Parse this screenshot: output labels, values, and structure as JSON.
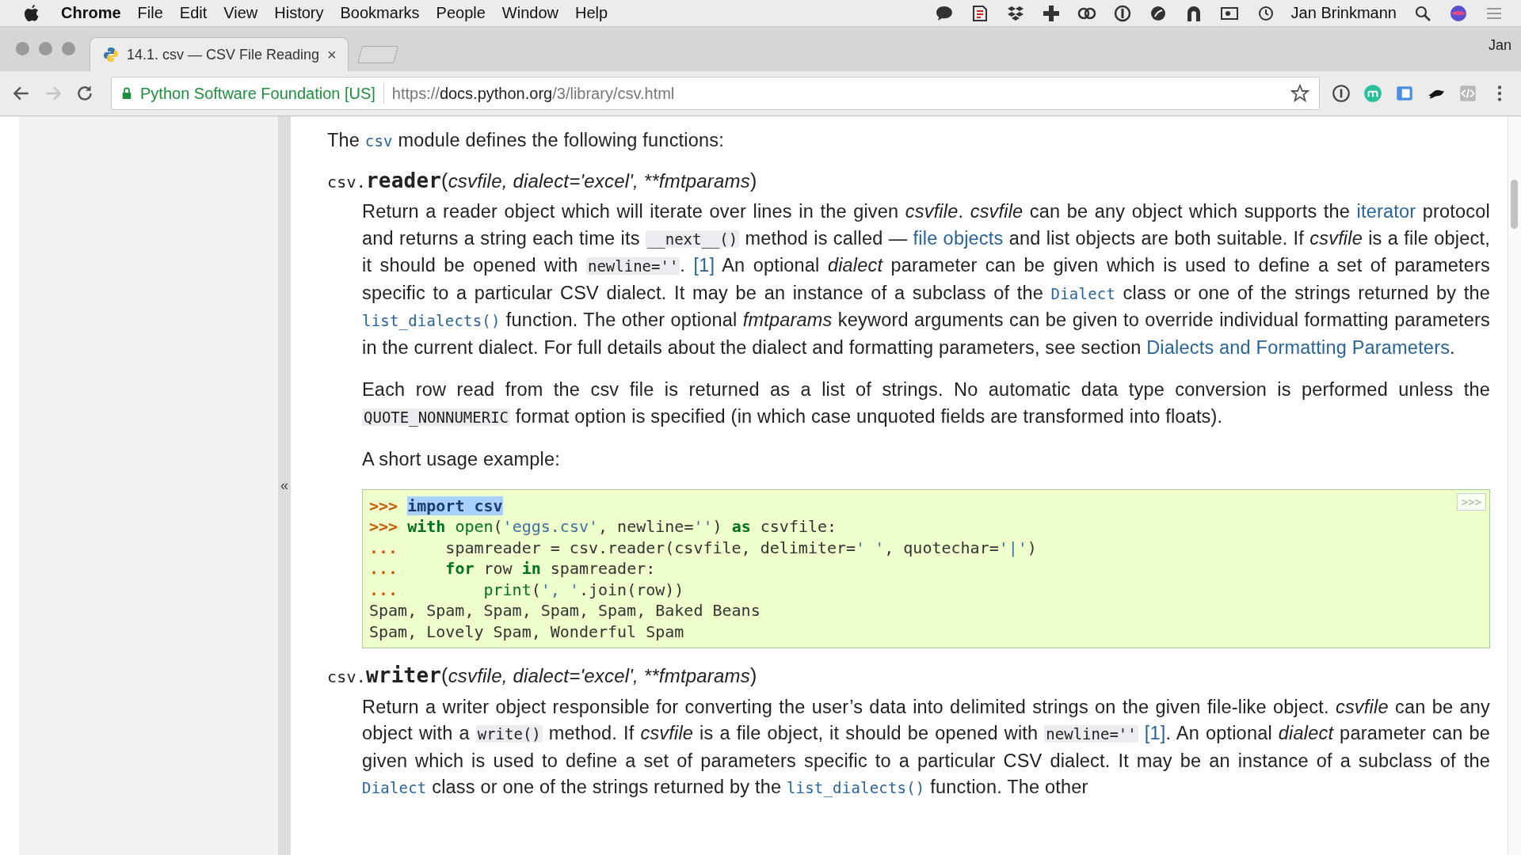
{
  "menu_bar": {
    "app_name": "Chrome",
    "menus": [
      "File",
      "Edit",
      "View",
      "History",
      "Bookmarks",
      "People",
      "Window",
      "Help"
    ],
    "user": "Jan Brinkmann"
  },
  "tabs": [
    {
      "title": "14.1. csv — CSV File Reading",
      "selected": true,
      "close": "×"
    }
  ],
  "profile": "Jan",
  "toolbar": {
    "back_enabled": true,
    "forward_enabled": false,
    "site_identity": "Python Software Foundation [US]",
    "url_scheme": "https://",
    "url_host": "docs.python.org",
    "url_path": "/3/library/csv.html"
  },
  "sidebar": {
    "collapse": "«"
  },
  "content": [
    {
      "kind": "para",
      "segments": [
        {
          "kind": "text",
          "text": "The "
        },
        {
          "kind": "code_link",
          "text": "csv"
        },
        {
          "kind": "text",
          "text": " module defines the following functions:"
        }
      ]
    },
    {
      "kind": "function",
      "module": "csv.",
      "name": "reader",
      "open": "(",
      "params": "csvfile, dialect='excel', **fmtparams",
      "close": ")",
      "body": [
        {
          "kind": "para",
          "segments": [
            {
              "kind": "text",
              "text": "Return a reader object which will iterate over lines in the given *csvfile*. *csvfile* can be any object which supports the "
            },
            {
              "kind": "link",
              "text": "iterator"
            },
            {
              "kind": "text",
              "text": " protocol and returns a string each time its "
            },
            {
              "kind": "code",
              "text": "__next__()"
            },
            {
              "kind": "text",
              "text": " method is called — "
            },
            {
              "kind": "link",
              "text": "file objects"
            },
            {
              "kind": "text",
              "text": " and list objects are both suitable. If *csvfile* is a file object, it should be opened with "
            },
            {
              "kind": "code",
              "text": "newline=''"
            },
            {
              "kind": "text",
              "text": ". "
            },
            {
              "kind": "link",
              "text": "[1]"
            },
            {
              "kind": "text",
              "text": " An optional *dialect* parameter can be given which is used to define a set of parameters specific to a particular CSV dialect. It may be an instance of a subclass of the "
            },
            {
              "kind": "code_link",
              "text": "Dialect"
            },
            {
              "kind": "text",
              "text": " class or one of the strings returned by the "
            },
            {
              "kind": "code_link",
              "text": "list_dialects()"
            },
            {
              "kind": "text",
              "text": " function. The other optional *fmtparams* keyword arguments can be given to override individual formatting parameters in the current dialect. For full details about the dialect and formatting parameters, see section "
            },
            {
              "kind": "link",
              "text": "Dialects and Formatting Parameters"
            },
            {
              "kind": "text",
              "text": "."
            }
          ]
        },
        {
          "kind": "para",
          "segments": [
            {
              "kind": "text",
              "text": "Each row read from the csv file is returned as a list of strings. No automatic data type conversion is performed unless the "
            },
            {
              "kind": "code",
              "text": "QUOTE_NONNUMERIC"
            },
            {
              "kind": "text",
              "text": " format option is specified (in which case unquoted fields are transformed into floats)."
            }
          ]
        },
        {
          "kind": "para",
          "segments": [
            {
              "kind": "text",
              "text": "A short usage example:"
            }
          ]
        },
        {
          "kind": "code",
          "copy_button": ">>>",
          "lines": [
            [
              {
                "kind": "prompt",
                "text": ">>> "
              },
              {
                "kind": "keyword",
                "text": "import",
                "highlighted": true
              },
              {
                "kind": "namespace",
                "text": " csv",
                "highlighted": true
              }
            ],
            [
              {
                "kind": "prompt",
                "text": ">>> "
              },
              {
                "kind": "keyword",
                "text": "with"
              },
              {
                "kind": "builtin",
                "text": " open"
              },
              {
                "kind": "plain",
                "text": "("
              },
              {
                "kind": "string",
                "text": "'eggs.csv'"
              },
              {
                "kind": "plain",
                "text": ", newline="
              },
              {
                "kind": "string",
                "text": "''"
              },
              {
                "kind": "plain",
                "text": ") "
              },
              {
                "kind": "keyword",
                "text": "as"
              },
              {
                "kind": "plain",
                "text": " csvfile:"
              }
            ],
            [
              {
                "kind": "prompt",
                "text": "... "
              },
              {
                "kind": "plain",
                "text": "    spamreader = csv.reader(csvfile, delimiter="
              },
              {
                "kind": "string",
                "text": "' '"
              },
              {
                "kind": "plain",
                "text": ", quotechar="
              },
              {
                "kind": "string",
                "text": "'|'"
              },
              {
                "kind": "plain",
                "text": ")"
              }
            ],
            [
              {
                "kind": "prompt",
                "text": "... "
              },
              {
                "kind": "keyword",
                "text": "    for"
              },
              {
                "kind": "plain",
                "text": " row "
              },
              {
                "kind": "keyword",
                "text": "in"
              },
              {
                "kind": "plain",
                "text": " spamreader:"
              }
            ],
            [
              {
                "kind": "prompt",
                "text": "... "
              },
              {
                "kind": "builtin",
                "text": "        print"
              },
              {
                "kind": "plain",
                "text": "("
              },
              {
                "kind": "string",
                "text": "', '"
              },
              {
                "kind": "plain",
                "text": ".join(row))"
              }
            ],
            [
              {
                "kind": "output",
                "text": "Spam, Spam, Spam, Spam, Spam, Baked Beans"
              }
            ],
            [
              {
                "kind": "output",
                "text": "Spam, Lovely Spam, Wonderful Spam"
              }
            ]
          ]
        }
      ]
    },
    {
      "kind": "function",
      "module": "csv.",
      "name": "writer",
      "open": "(",
      "params": "csvfile, dialect='excel', **fmtparams",
      "close": ")",
      "body": [
        {
          "kind": "para",
          "segments": [
            {
              "kind": "text",
              "text": "Return a writer object responsible for converting the user’s data into delimited strings on the given file-like object. *csvfile* can be any object with a "
            },
            {
              "kind": "code",
              "text": "write()"
            },
            {
              "kind": "text",
              "text": " method. If *csvfile* is a file object, it should be opened with "
            },
            {
              "kind": "code",
              "text": "newline=''",
              "space_after": true
            },
            {
              "kind": "link",
              "text": "[1]"
            },
            {
              "kind": "text",
              "text": ". An optional *dialect* parameter can be given which is used to define a set of parameters specific to a particular CSV dialect. It may be an instance of a subclass of the "
            },
            {
              "kind": "code_link",
              "text": "Dialect"
            },
            {
              "kind": "text",
              "text": " class or one of the strings returned by the "
            },
            {
              "kind": "code_link",
              "text": "list_dialects()"
            },
            {
              "kind": "text",
              "text": " function. The other"
            }
          ]
        }
      ]
    }
  ]
}
